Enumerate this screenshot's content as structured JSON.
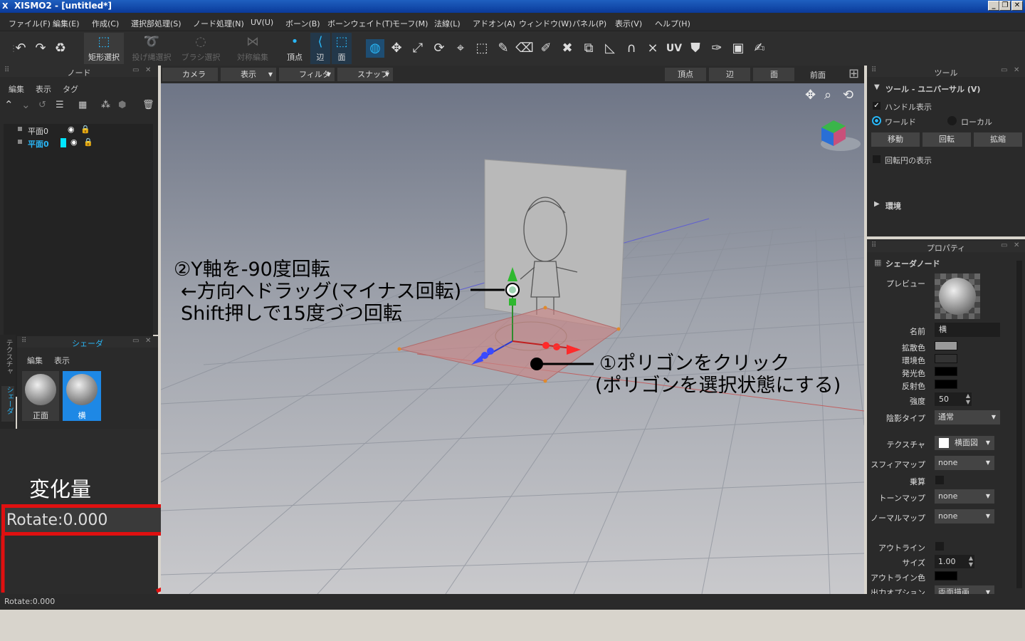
{
  "window": {
    "title": "XISMO2 - [untitled*]",
    "logo": "X"
  },
  "menu": [
    "ファイル(F)",
    "編集(E)",
    "作成(C)",
    "選択部処理(S)",
    "ノード処理(N)",
    "UV(U)",
    "ボーン(B)",
    "ボーンウェイト(T)",
    "モーフ(M)",
    "法線(L)",
    "アドオン(A)",
    "ウィンドウ(W)",
    "パネル(P)",
    "表示(V)",
    "ヘルプ(H)"
  ],
  "toolbar": {
    "undo_icon": "undo-icon",
    "redo_icon": "redo-icon",
    "recycle_icon": "recycle-icon",
    "select_modes": [
      {
        "label": "矩形選択",
        "icon": "rect-select-icon",
        "active": true
      },
      {
        "label": "投げ縄選択",
        "icon": "lasso-select-icon",
        "active": false
      },
      {
        "label": "ブラシ選択",
        "icon": "brush-select-icon",
        "active": false
      },
      {
        "label": "対称編集",
        "icon": "symmetry-icon",
        "active": false
      }
    ],
    "elements": [
      {
        "label": "頂点",
        "icon": "vertex-icon"
      },
      {
        "label": "辺",
        "icon": "edge-icon"
      },
      {
        "label": "面",
        "icon": "face-icon"
      }
    ]
  },
  "node_panel": {
    "title": "ノード",
    "submenu": [
      "編集",
      "表示",
      "タグ"
    ],
    "items": [
      {
        "label": "平面0",
        "selected": false
      },
      {
        "label": "平面0",
        "selected": true
      }
    ]
  },
  "shader_panel": {
    "title": "シェーダ",
    "submenu": [
      "編集",
      "表示"
    ],
    "items": [
      {
        "label": "正面",
        "selected": false
      },
      {
        "label": "横",
        "selected": true
      }
    ],
    "side_tabs": [
      "テクスチャ",
      "シェーダ"
    ]
  },
  "change_panel": {
    "label": "変化量",
    "value": "Rotate:0.000"
  },
  "viewport_bar": {
    "left": [
      "カメラ",
      "表示",
      "フィルタ",
      "スナップ"
    ],
    "right": [
      "頂点",
      "辺",
      "面",
      "前面"
    ]
  },
  "annotations": {
    "step2_line1": "②Y軸を-90度回転",
    "step2_line2": "←方向へドラッグ(マイナス回転)",
    "step2_line3": "Shift押しで15度づつ回転",
    "step1_line1": "①ポリゴンをクリック",
    "step1_line2": "(ポリゴンを選択状態にする)"
  },
  "tool_panel": {
    "header": "ツール",
    "section": "ツール - ユニバーサル (V)",
    "show_handle": "ハンドル表示",
    "world": "ワールド",
    "local": "ローカル",
    "buttons": [
      "移動",
      "回転",
      "拡縮"
    ],
    "show_rot_circle": "回転円の表示",
    "env": "環境"
  },
  "property_panel": {
    "header": "プロパティ",
    "section": "シェーダノード",
    "preview": "プレビュー",
    "name_label": "名前",
    "name_value": "横",
    "diffuse": "拡散色",
    "ambient": "環境色",
    "emissive": "発光色",
    "reflect": "反射色",
    "strength_label": "強度",
    "strength_value": "50",
    "shade_type_label": "陰影タイプ",
    "shade_type_value": "通常",
    "texture_label": "テクスチャ",
    "texture_value": "横面図",
    "sphere_label": "スフィアマップ",
    "sphere_value": "none",
    "multiply_label": "乗算",
    "toon_label": "トーンマップ",
    "toon_value": "none",
    "normal_label": "ノーマルマップ",
    "normal_value": "none",
    "outline_label": "アウトライン",
    "size_label": "サイズ",
    "size_value": "1.00",
    "outline_color_label": "アウトライン色",
    "output_label": "出力オプション",
    "output_value": "両面描画"
  },
  "status": {
    "text": "Rotate:0.000"
  },
  "colors": {
    "accent": "#29b6f6",
    "highlight_red": "#e01010",
    "panel": "#2a2a2a"
  }
}
